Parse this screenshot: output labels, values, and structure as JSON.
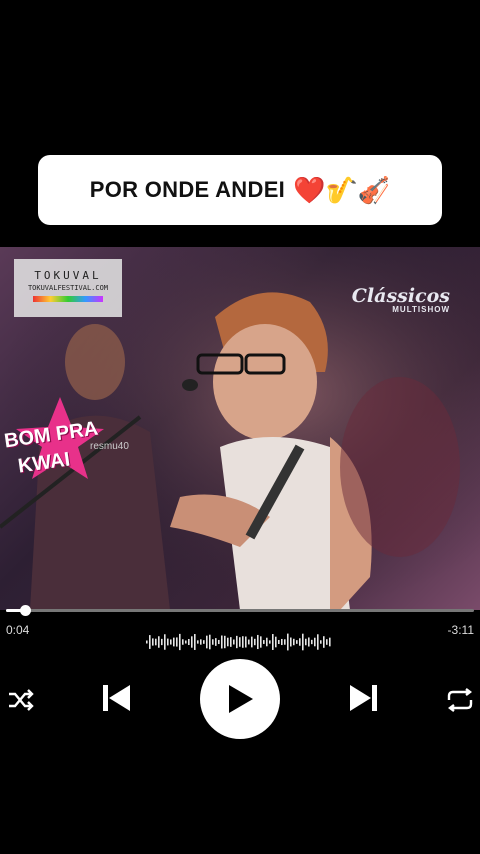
{
  "title_card": {
    "text": "POR ONDE ANDEI",
    "emojis": "❤️🎷🎻"
  },
  "video": {
    "watermark_tokuval": "TOKUVAL",
    "watermark_tokuval_url": "TOKUVALFESTIVAL.COM",
    "watermark_classicos": "Clássicos",
    "watermark_multishow": "MULTISHOW",
    "badge_line1": "BOM PRA",
    "badge_line2": "KWAI",
    "badge_user": "resmu40"
  },
  "player": {
    "progress": 0.04,
    "elapsed": "0:04",
    "remaining": "-3:11"
  },
  "controls": {
    "shuffle_icon": "shuffle-icon",
    "prev_icon": "skip-previous-icon",
    "play_icon": "play-icon",
    "next_icon": "skip-next-icon",
    "repeat_icon": "repeat-icon"
  }
}
